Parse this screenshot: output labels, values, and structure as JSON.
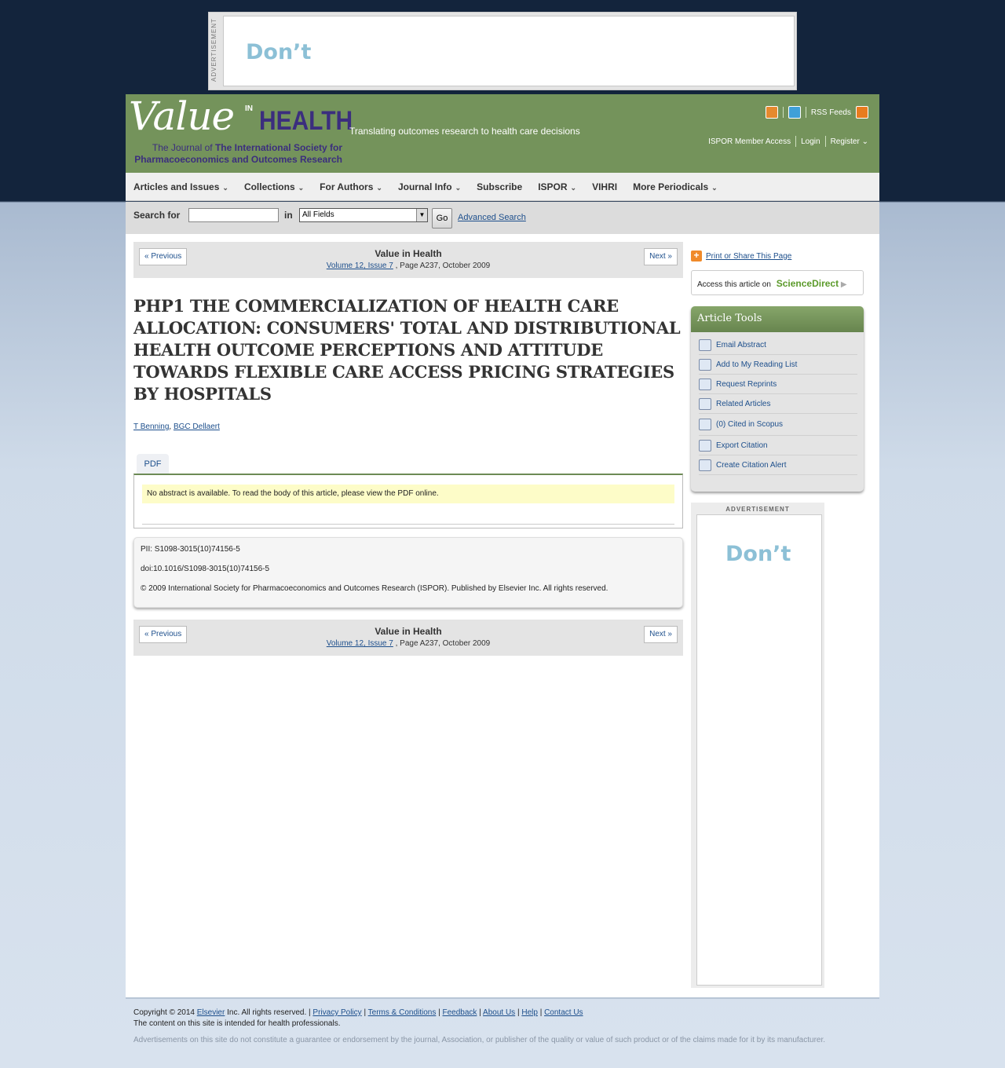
{
  "ads": {
    "top_label": "ADVERTISEMENT",
    "top_text": "Don’t",
    "side_label": "ADVERTISEMENT",
    "side_text": "Don’t"
  },
  "header": {
    "logo_value": "Value",
    "logo_in": "IN",
    "logo_health": "HEALTH",
    "logo_sub_thin": "The Journal of",
    "logo_sub_bold1": "The International Society for",
    "logo_sub_bold2": "Pharmacoeconomics and Outcomes Research",
    "tagline": "Translating outcomes research to health care decisions",
    "rss": "RSS Feeds",
    "links": [
      "ISPOR Member Access",
      "Login",
      "Register"
    ]
  },
  "nav": [
    {
      "label": "Articles and Issues",
      "dropdown": true
    },
    {
      "label": "Collections",
      "dropdown": true
    },
    {
      "label": "For Authors",
      "dropdown": true
    },
    {
      "label": "Journal Info",
      "dropdown": true
    },
    {
      "label": "Subscribe",
      "dropdown": false
    },
    {
      "label": "ISPOR",
      "dropdown": true
    },
    {
      "label": "VIHRI",
      "dropdown": false
    },
    {
      "label": "More Periodicals",
      "dropdown": true
    }
  ],
  "search": {
    "label": "Search for",
    "value": "",
    "in_label": "in",
    "field": "All Fields",
    "go": "Go",
    "advanced": "Advanced Search"
  },
  "pager": {
    "prev": "« Previous",
    "next": "Next »",
    "journal": "Value in Health",
    "volume_link": "Volume 12, Issue 7",
    "page_info": ", Page A237, October 2009"
  },
  "article": {
    "title": "PHP1 THE COMMERCIALIZATION OF HEALTH CARE ALLOCATION: CONSUMERS' TOTAL AND DISTRIBUTIONAL HEALTH OUTCOME PERCEPTIONS AND ATTITUDE TOWARDS FLEXIBLE CARE ACCESS PRICING STRATEGIES BY HOSPITALS",
    "authors": [
      "T Benning",
      "BGC Dellaert"
    ],
    "tab": "PDF",
    "abstract_note": "No abstract is available. To read the body of this article, please view the PDF online.",
    "pii": "PII: S1098-3015(10)74156-5",
    "doi": "doi:10.1016/S1098-3015(10)74156-5",
    "copyright": "© 2009 International Society for Pharmacoeconomics and Outcomes Research (ISPOR). Published by Elsevier Inc. All rights reserved."
  },
  "sidebar": {
    "print": "Print or Share This Page",
    "access": "Access this article on",
    "sciencedirect": "ScienceDirect",
    "tools_title": "Article Tools",
    "tools": [
      "Email Abstract",
      "Add to My Reading List",
      "Request Reprints",
      "Related Articles",
      "(0) Cited in Scopus",
      "Export Citation",
      "Create Citation Alert"
    ]
  },
  "footer": {
    "copyright_pre": "Copyright © 2014",
    "elsevier": "Elsevier",
    "copyright_post": "Inc. All rights reserved. |",
    "links": [
      "Privacy Policy",
      "Terms & Conditions",
      "Feedback",
      "About Us",
      "Help",
      "Contact Us"
    ],
    "line2": "The content on this site is intended for health professionals.",
    "disclaimer": "Advertisements on this site do not constitute a guarantee or endorsement by the journal, Association, or publisher of the quality or value of such product or of the claims made for it by its manufacturer."
  }
}
